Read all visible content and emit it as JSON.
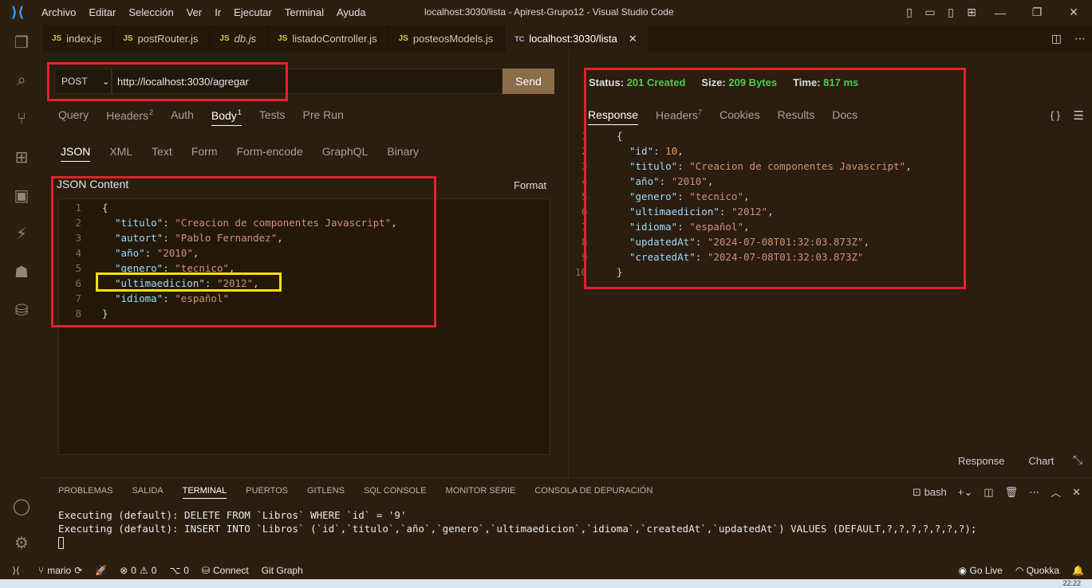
{
  "titlebar": {
    "menu": [
      "Archivo",
      "Editar",
      "Selección",
      "Ver",
      "Ir",
      "Ejecutar",
      "Terminal",
      "Ayuda"
    ],
    "title": "localhost:3030/lista - Apirest-Grupo12 - Visual Studio Code"
  },
  "tabs": [
    {
      "label": "index.js",
      "icon": "JS"
    },
    {
      "label": "postRouter.js",
      "icon": "JS"
    },
    {
      "label": "db.js",
      "icon": "JS"
    },
    {
      "label": "listadoController.js",
      "icon": "JS"
    },
    {
      "label": "posteosModels.js",
      "icon": "JS"
    },
    {
      "label": "localhost:3030/lista",
      "icon": "TC"
    }
  ],
  "request": {
    "method": "POST",
    "url": "http://localhost:3030/agregar",
    "send_label": "Send",
    "tabs": [
      "Query",
      "Headers",
      "Auth",
      "Body",
      "Tests",
      "Pre Run"
    ],
    "headers_count": "2",
    "body_count": "1",
    "body_types": [
      "JSON",
      "XML",
      "Text",
      "Form",
      "Form-encode",
      "GraphQL",
      "Binary"
    ],
    "json_label": "JSON Content",
    "format_label": "Format",
    "lines": [
      "1",
      "2",
      "3",
      "4",
      "5",
      "6",
      "7",
      "8"
    ],
    "body": {
      "open": "{",
      "close": "}",
      "fields": [
        {
          "key": "\"titulo\"",
          "value": "\"Creacion de componentes Javascript\"",
          "comma": ","
        },
        {
          "key": "\"autort\"",
          "value": "\"Pablo Fernandez\"",
          "comma": ","
        },
        {
          "key": "\"año\"",
          "value": "\"2010\"",
          "comma": ","
        },
        {
          "key": "\"genero\"",
          "value": "\"tecnico\"",
          "comma": ","
        },
        {
          "key": "\"ultimaedicion\"",
          "value": "\"2012\"",
          "comma": ","
        },
        {
          "key": "\"idioma\"",
          "value": "\"español\"",
          "comma": ""
        }
      ]
    }
  },
  "response": {
    "status_label": "Status:",
    "status_value": "201 Created",
    "size_label": "Size:",
    "size_value": "209 Bytes",
    "time_label": "Time:",
    "time_value": "817 ms",
    "tabs": [
      "Response",
      "Headers",
      "Cookies",
      "Results",
      "Docs"
    ],
    "headers_count": "7",
    "braces": "{ }",
    "lines": [
      "1",
      "2",
      "3",
      "4",
      "5",
      "6",
      "7",
      "8",
      "9",
      "10"
    ],
    "body": {
      "open": "{",
      "close": "}",
      "fields": [
        {
          "key": "\"id\"",
          "value": "10",
          "comma": ",",
          "num": true
        },
        {
          "key": "\"titulo\"",
          "value": "\"Creacion de componentes Javascript\"",
          "comma": ","
        },
        {
          "key": "\"año\"",
          "value": "\"2010\"",
          "comma": ","
        },
        {
          "key": "\"genero\"",
          "value": "\"tecnico\"",
          "comma": ","
        },
        {
          "key": "\"ultimaedicion\"",
          "value": "\"2012\"",
          "comma": ","
        },
        {
          "key": "\"idioma\"",
          "value": "\"español\"",
          "comma": ","
        },
        {
          "key": "\"updatedAt\"",
          "value": "\"2024-07-08T01:32:03.873Z\"",
          "comma": ","
        },
        {
          "key": "\"createdAt\"",
          "value": "\"2024-07-08T01:32:03.873Z\"",
          "comma": ""
        }
      ]
    },
    "footer": [
      "Response",
      "Chart"
    ]
  },
  "panel": {
    "tabs": [
      "PROBLEMAS",
      "SALIDA",
      "TERMINAL",
      "PUERTOS",
      "GITLENS",
      "SQL CONSOLE",
      "MONITOR SERIE",
      "CONSOLA DE DEPURACIÓN"
    ],
    "shell": "bash",
    "terminal_lines": [
      "Executing (default): DELETE FROM `Libros` WHERE `id` = '9'",
      "Executing (default): INSERT INTO `Libros` (`id`,`titulo`,`año`,`genero`,`ultimaedicion`,`idioma`,`createdAt`,`updatedAt`) VALUES (DEFAULT,?,?,?,?,?,?,?);"
    ]
  },
  "statusbar": {
    "branch": "mario",
    "errors": "0",
    "warnings": "0",
    "ports": "0",
    "connect": "Connect",
    "gitgraph": "Git Graph",
    "golive": "Go Live",
    "quokka": "Quokka"
  },
  "taskbar": {
    "clock": "22:22"
  },
  "colors": {
    "highlight_red": "#e0242b",
    "highlight_yellow": "#f4e300",
    "status_green": "#4ec94e",
    "send_button": "#8a6c48"
  }
}
